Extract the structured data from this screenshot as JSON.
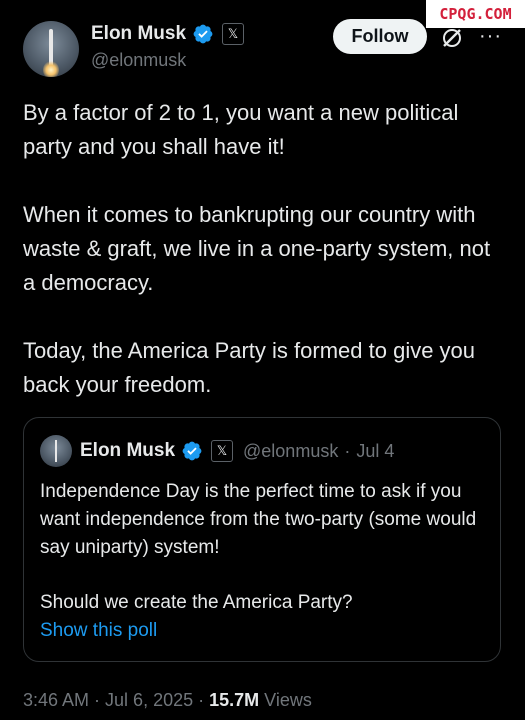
{
  "watermark": "CPQG.COM",
  "author": {
    "name": "Elon Musk",
    "handle": "@elonmusk",
    "affiliation_badge": "𝕏",
    "verified_color": "#1d9bf0"
  },
  "actions": {
    "follow_label": "Follow",
    "more_label": "···"
  },
  "tweet": {
    "paragraphs": [
      "By a factor of 2 to 1, you want a new political party and you shall have it!",
      "When it comes to bankrupting our country with waste & graft, we live in a one-party system, not a democracy.",
      "Today, the America Party is formed to give you back your freedom."
    ]
  },
  "quoted_tweet": {
    "name": "Elon Musk",
    "handle": "@elonmusk",
    "separator": "·",
    "date": "Jul 4",
    "affiliation_badge": "𝕏",
    "paragraphs": [
      "Independence Day is the perfect time to ask if you want independence from the two-party (some would say uniparty) system!",
      "Should we create the America Party?"
    ],
    "poll_link": "Show this poll"
  },
  "meta": {
    "time": "3:46 AM",
    "sep1": "·",
    "date": "Jul 6, 2025",
    "sep2": "·",
    "views_count": "15.7M",
    "views_label": "Views"
  },
  "colors": {
    "background": "#000000",
    "text": "#e7e9ea",
    "secondary": "#71767b",
    "link": "#1d9bf0",
    "border": "#2f3336"
  }
}
